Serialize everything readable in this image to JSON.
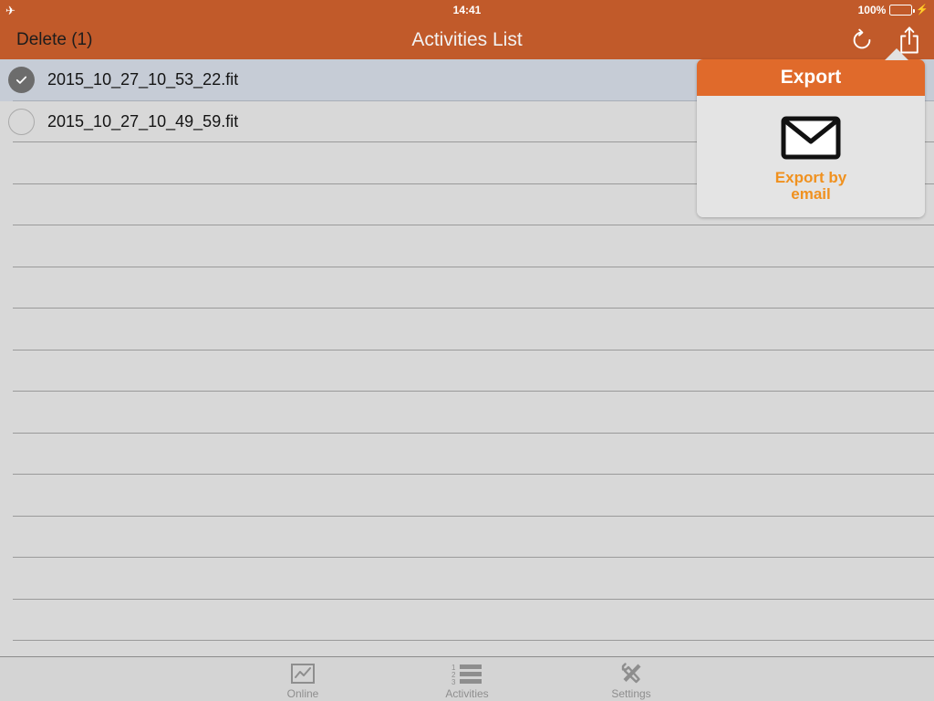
{
  "status_bar": {
    "airplane_icon": "airplane-mode-icon",
    "time": "14:41",
    "battery_percent": "100%",
    "battery_icon": "battery-full-icon",
    "charging_icon": "lightning-bolt-icon"
  },
  "nav_bar": {
    "delete_label": "Delete (1)",
    "title": "Activities List",
    "refresh_icon": "refresh-icon",
    "share_icon": "share-icon",
    "background_color": "#c15a2a"
  },
  "list": {
    "rows": [
      {
        "filename": "2015_10_27_10_53_22.fit",
        "selected": true
      },
      {
        "filename": "2015_10_27_10_49_59.fit",
        "selected": false
      }
    ],
    "empty_row_count": 12,
    "selected_row_color": "#c6ccd6",
    "background_color": "#d8d8d8"
  },
  "popover": {
    "title": "Export",
    "header_color": "#e06a2b",
    "body_color": "#e4e4e4",
    "items": [
      {
        "icon": "envelope-icon",
        "label": "Export by email",
        "label_line_1": "Export by",
        "label_line_2": "email",
        "label_color": "#f0911f"
      }
    ]
  },
  "tab_bar": {
    "tabs": [
      {
        "label": "Online",
        "icon": "line-chart-icon",
        "active": false
      },
      {
        "label": "Activities",
        "icon": "numbered-list-icon",
        "active": false
      },
      {
        "label": "Settings",
        "icon": "tools-icon",
        "active": false
      }
    ],
    "numbered_list_digits": [
      "1",
      "2",
      "3"
    ],
    "label_color": "#8e8e8e",
    "background_color": "#d4d4d4"
  }
}
